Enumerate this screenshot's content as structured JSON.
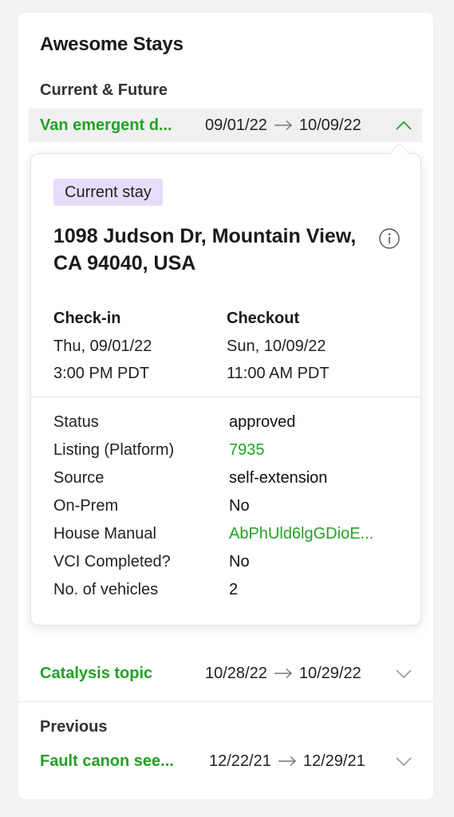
{
  "panel": {
    "title": "Awesome Stays"
  },
  "sections": {
    "current_future": "Current & Future",
    "previous": "Previous"
  },
  "stays": {
    "active": {
      "name": "Van emergent d...",
      "check_in": "09/01/22",
      "check_out": "10/09/22",
      "expanded": true
    },
    "second": {
      "name": "Catalysis topic",
      "check_in": "10/28/22",
      "check_out": "10/29/22",
      "expanded": false
    },
    "previous": {
      "name": "Fault canon see...",
      "check_in": "12/22/21",
      "check_out": "12/29/21",
      "expanded": false
    }
  },
  "details": {
    "badge": "Current stay",
    "address": "1098 Judson Dr, Mountain View, CA 94040, USA",
    "checkin_label": "Check-in",
    "checkin_date": "Thu, 09/01/22",
    "checkin_time": "3:00 PM PDT",
    "checkout_label": "Checkout",
    "checkout_date": "Sun, 10/09/22",
    "checkout_time": "11:00 AM PDT",
    "fields": [
      {
        "label": "Status",
        "value": "approved"
      },
      {
        "label": "Listing (Platform)",
        "value": "7935"
      },
      {
        "label": "Source",
        "value": "self-extension"
      },
      {
        "label": "On-Prem",
        "value": "No"
      },
      {
        "label": "House Manual",
        "value": "AbPhUld6lgGDioE..."
      },
      {
        "label": "VCI Completed?",
        "value": "No"
      },
      {
        "label": "No. of vehicles",
        "value": "2"
      }
    ]
  },
  "colors": {
    "accent": "#23a127",
    "badge_bg": "#e7dcf9"
  },
  "icons": [
    "arrow-right-icon",
    "chevron-up-icon",
    "chevron-down-icon",
    "info-icon"
  ]
}
